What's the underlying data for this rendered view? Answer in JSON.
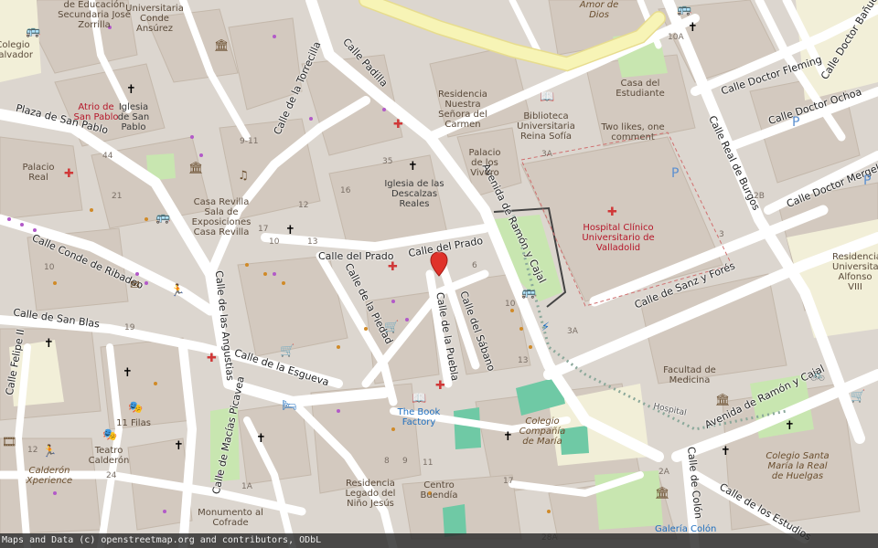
{
  "map": {
    "attribution": "Maps and Data (c) openstreetmap.org and contributors, ODbL",
    "colors": {
      "background": "#dcd6cf",
      "road": "#ffffff",
      "primary_road": "#f7f4b6",
      "building": "#d3c9bf",
      "park": "#c8e6b0",
      "hospital_accent": "#d03838",
      "water_blue": "#1f6fbf",
      "marker": "#e0322a"
    },
    "streets": [
      "Calle de la Torrecilla",
      "Calle Padilla",
      "Plaza de San Pablo",
      "Calle Conde de Ribadeo",
      "Calle de San Blas",
      "Calle Felipe II",
      "Calle de las Angustias",
      "Calle de la Esgueva",
      "Calle de Macías Picavea",
      "Calle del Prado",
      "Calle de la Piedad",
      "Calle de la Puebla",
      "Calle del Sábano",
      "Avenida de Ramón y Cajal",
      "Calle de Sanz y Forés",
      "Calle Real de Burgos",
      "Calle Doctor Fleming",
      "Calle Doctor Ochoa",
      "Calle Doctor Mergelina",
      "Calle Doctor Bañuelos",
      "Calle de Colón",
      "Calle de los Estudios",
      "Hospital"
    ],
    "places": [
      {
        "name": "de Educación Secundaria José Zorrilla"
      },
      {
        "name": "Universitaria Conde Ansúrez"
      },
      {
        "name": "Colegio Salvador"
      },
      {
        "name": "Atrio de San Pablo"
      },
      {
        "name": "Iglesia de San Pablo"
      },
      {
        "name": "Palacio Real"
      },
      {
        "name": "Casa Revilla Sala de Exposiciones Casa Revilla"
      },
      {
        "name": "Iglesia de las Descalzas Reales"
      },
      {
        "name": "Residencia Nuestra Señora del Carmen"
      },
      {
        "name": "Palacio de los Vivero"
      },
      {
        "name": "Biblioteca Universitaria Reina Sofía"
      },
      {
        "name": "Casa del Estudiante"
      },
      {
        "name": "Two likes, one comment"
      },
      {
        "name": "Amor de Dios"
      },
      {
        "name": "Hospital Clínico Universitario de Valladolid"
      },
      {
        "name": "Facultad de Medicina"
      },
      {
        "name": "The Book Factory"
      },
      {
        "name": "Colegio Compañía de María"
      },
      {
        "name": "11 Filas"
      },
      {
        "name": "Teatro Calderón"
      },
      {
        "name": "Calderón Xperience"
      },
      {
        "name": "Residencia Legado del Niño Jesús"
      },
      {
        "name": "Centro Buendía"
      },
      {
        "name": "Monumento al Cofrade"
      },
      {
        "name": "Colegio Santa María la Real de Huelgas"
      },
      {
        "name": "Residencia Universitaria Alfonso VIII"
      },
      {
        "name": "Galería Colón"
      }
    ]
  }
}
